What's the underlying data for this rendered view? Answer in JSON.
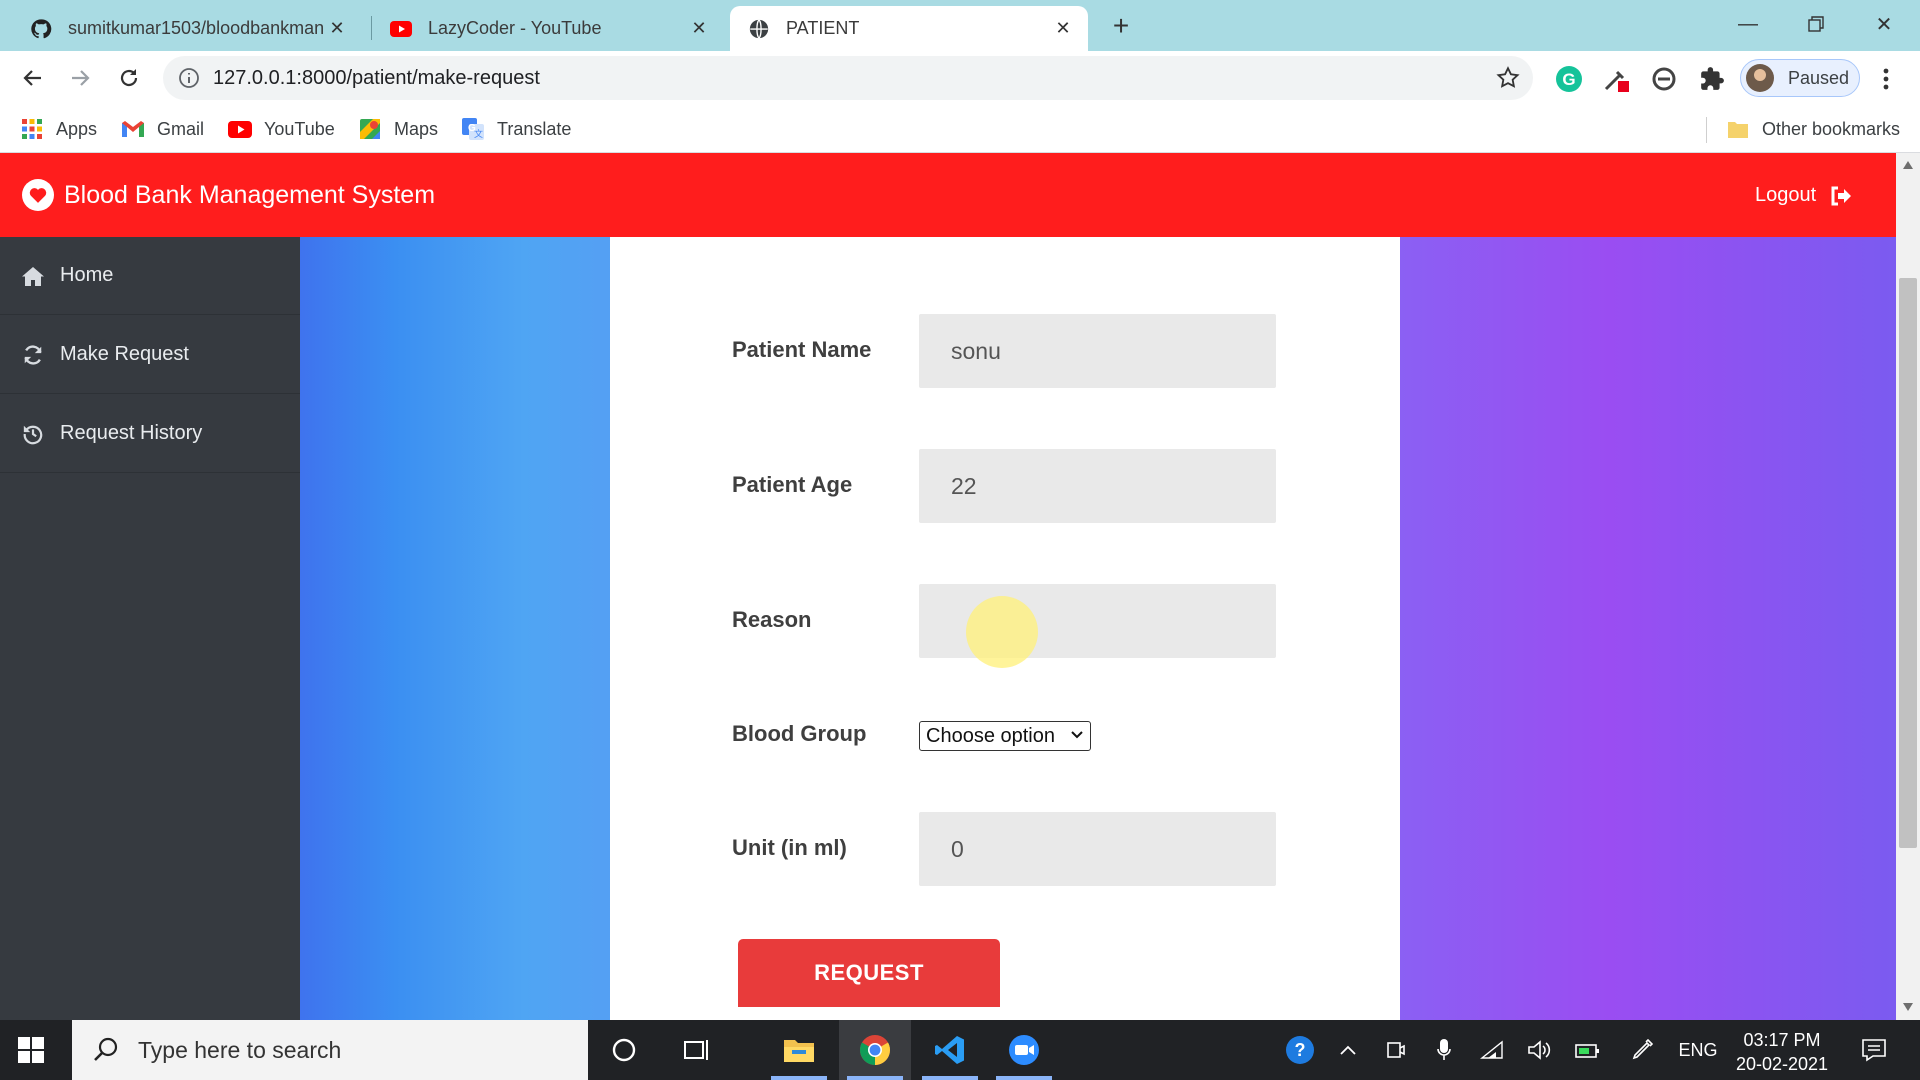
{
  "browser": {
    "tabs": [
      {
        "title": "sumitkumar1503/bloodbankman",
        "favicon": "github-icon"
      },
      {
        "title": "LazyCoder - YouTube",
        "favicon": "youtube-icon"
      },
      {
        "title": "PATIENT",
        "favicon": "globe-icon",
        "active": true
      }
    ],
    "url": "127.0.0.1:8000/patient/make-request",
    "profile_label": "Paused",
    "bookmarks": [
      {
        "label": "Apps",
        "icon": "apps-grid-icon"
      },
      {
        "label": "Gmail",
        "icon": "gmail-icon"
      },
      {
        "label": "YouTube",
        "icon": "youtube-icon"
      },
      {
        "label": "Maps",
        "icon": "maps-icon"
      },
      {
        "label": "Translate",
        "icon": "translate-icon"
      }
    ],
    "other_bookmarks": "Other bookmarks"
  },
  "app": {
    "title": "Blood Bank Management System",
    "logout_label": "Logout",
    "accent_color": "#ff1d1d"
  },
  "sidebar": {
    "items": [
      {
        "label": "Home",
        "icon": "home-icon"
      },
      {
        "label": "Make Request",
        "icon": "refresh-icon"
      },
      {
        "label": "Request History",
        "icon": "history-icon"
      }
    ]
  },
  "form": {
    "patient_name": {
      "label": "Patient Name",
      "value": "sonu"
    },
    "patient_age": {
      "label": "Patient Age",
      "value": "22"
    },
    "reason": {
      "label": "Reason",
      "value": ""
    },
    "blood_group": {
      "label": "Blood Group",
      "selected": "Choose option"
    },
    "unit": {
      "label": "Unit (in ml)",
      "value": "0"
    },
    "submit_label": "REQUEST"
  },
  "taskbar": {
    "search_placeholder": "Type here to search",
    "language": "ENG",
    "time": "03:17 PM",
    "date": "20-02-2021"
  }
}
